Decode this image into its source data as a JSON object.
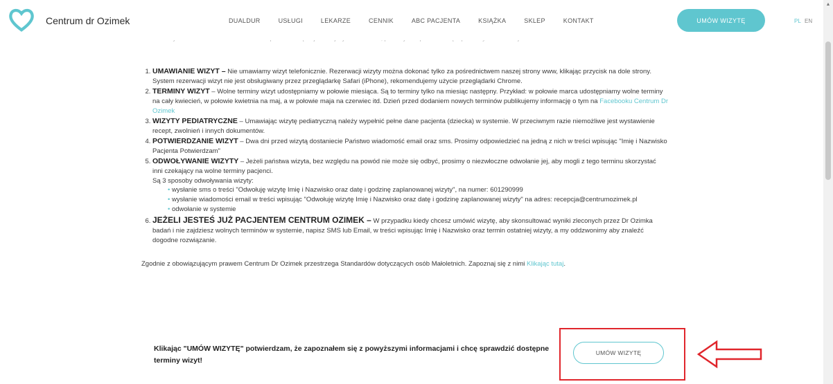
{
  "header": {
    "brand": "Centrum dr Ozimek",
    "logo_icon": "heart-icon",
    "nav": [
      "DUALDUR",
      "USŁUGI",
      "LEKARZE",
      "CENNIK",
      "ABC PACJENTA",
      "KSIĄŻKA",
      "SKLEP",
      "KONTAKT"
    ],
    "cta": "UMÓW WIZYTĘ",
    "lang_pl": "PL",
    "lang_en": "EN"
  },
  "faded_line": "Witamy w Centrum Dr Ozimek i w celu zapoznania się najważniejszymi kwestiami, prosimy o zapoznanie się z poniższymi informacjami.",
  "items": [
    {
      "title": "UMAWIANIE WIZYT –",
      "text": " Nie umawiamy wizyt telefonicznie. Rezerwacji wizyty można dokonać tylko za pośrednictwem naszej strony www, klikając przycisk na dole strony.",
      "extra": "System rezerwacji wizyt nie jest obsługiwany przez przeglądarkę Safari (iPhone), rekomendujemy użycie przeglądarki Chrome."
    },
    {
      "title": "TERMINY WIZYT",
      "text": " – Wolne terminy wizyt udostępniamy w połowie miesiąca. Są to terminy tylko na miesiąc następny. Przykład: w połowie marca udostępniamy wolne terminy na cały kwiecień, w połowie kwietnia na maj, a w połowie maja na czerwiec itd. Dzień przed dodaniem nowych terminów publikujemy informację o tym na ",
      "link": "Facebooku Centrum Dr Ozimek"
    },
    {
      "title": "WIZYTY PEDIATRYCZNE",
      "text": " – Umawiając wizytę pediatryczną należy wypełnić pełne dane pacjenta (dziecka) w systemie. W przeciwnym razie niemożliwe jest wystawienie recept, zwolnień i innych dokumentów."
    },
    {
      "title": "POTWIERDZANIE WIZYT",
      "text": " – Dwa dni przed wizytą dostaniecie Państwo wiadomość email oraz sms. Prosimy odpowiedzieć na jedną z nich w treści wpisując \"Imię i Nazwisko Pacjenta Potwierdzam\""
    },
    {
      "title": "ODWOŁYWANIE WIZYTY",
      "text": " – Jeżeli państwa wizyta, bez względu na powód nie może się odbyć, prosimy o niezwłoczne odwołanie jej, aby mogli z tego terminu skorzystać inni czekający na wolne terminy pacjenci.",
      "sub": "Są 3 sposoby odwoływania wizyty:",
      "bullets": [
        "wysłanie sms o treści \"Odwołuję wizytę Imię i Nazwisko oraz datę i godzinę zaplanowanej wizyty\", na numer: 601290999",
        "wysłanie wiadomości email w treści wpisując \"Odwołuję wizytę Imię i Nazwisko oraz datę i godzinę zaplanowanej wizyty\" na adres: recepcja@centrumozimek.pl",
        "odwołanie w systemie"
      ]
    },
    {
      "title": "JEŻELI JESTEŚ JUŻ PACJENTEM CENTRUM OZIMEK –",
      "text": " W przypadku kiedy chcesz umówić wizytę, aby skonsultować wyniki zleconych przez Dr Ozimka badań i nie zajdziesz wolnych terminów w systemie, napisz SMS lub Email, w treści wpisując Imię i Nazwisko oraz termin ostatniej wizyty, a my oddzwonimy aby znaleźć dogodne rozwiązanie."
    }
  ],
  "law_text": "Zgodnie z obowiązującym prawem Centrum Dr Ozimek przestrzega Standardów dotyczących osób Małoletnich. Zapoznaj się z nimi ",
  "law_link": "Klikając tutaj",
  "confirm_text": "Klikając  \"UMÓW WIZYTĘ\" potwierdzam, że zapoznałem się z powyższymi informacjami i chcę sprawdzić dostępne terminy wizyt!",
  "cta_bottom": "UMÓW WIZYTĘ",
  "colors": {
    "accent": "#5fc6cf",
    "highlight": "#e0252b"
  }
}
